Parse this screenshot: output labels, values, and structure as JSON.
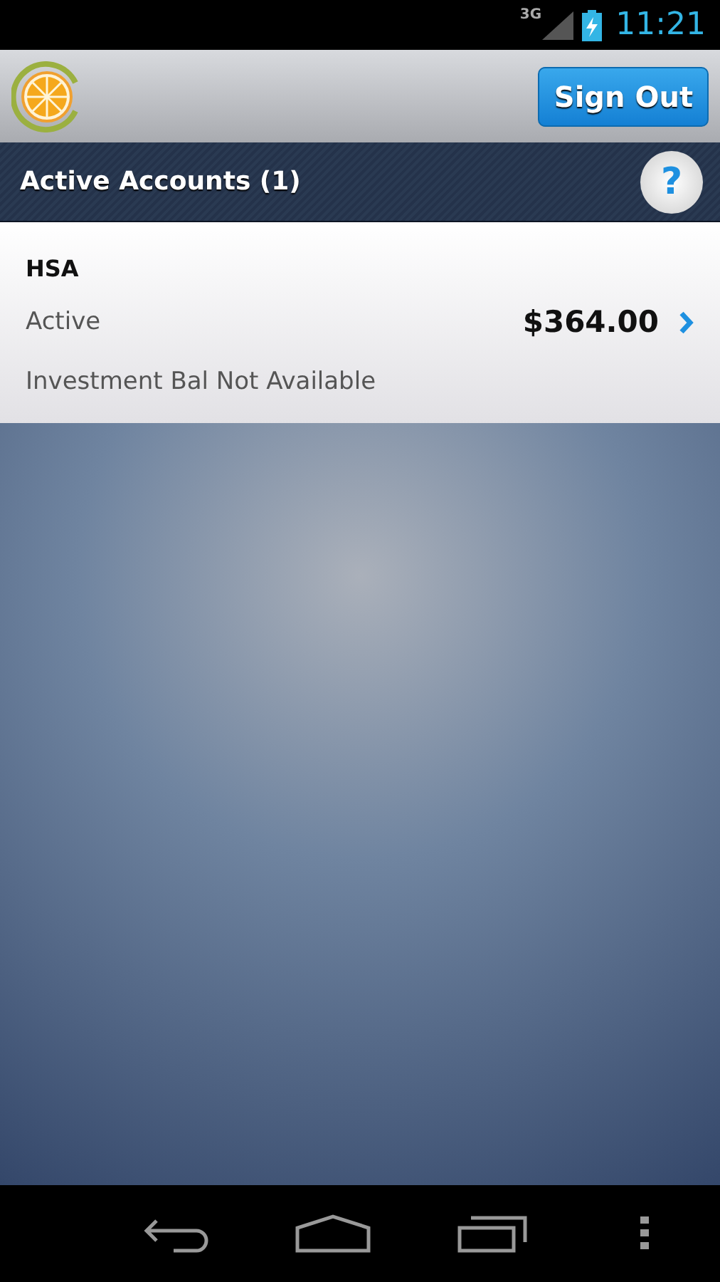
{
  "status_bar": {
    "network": "3G",
    "time": "11:21"
  },
  "header": {
    "sign_out": "Sign Out"
  },
  "section": {
    "title": "Active Accounts (1)",
    "help": "?"
  },
  "accounts": [
    {
      "name": "HSA",
      "status": "Active",
      "balance": "$364.00",
      "note": "Investment Bal Not Available"
    }
  ]
}
